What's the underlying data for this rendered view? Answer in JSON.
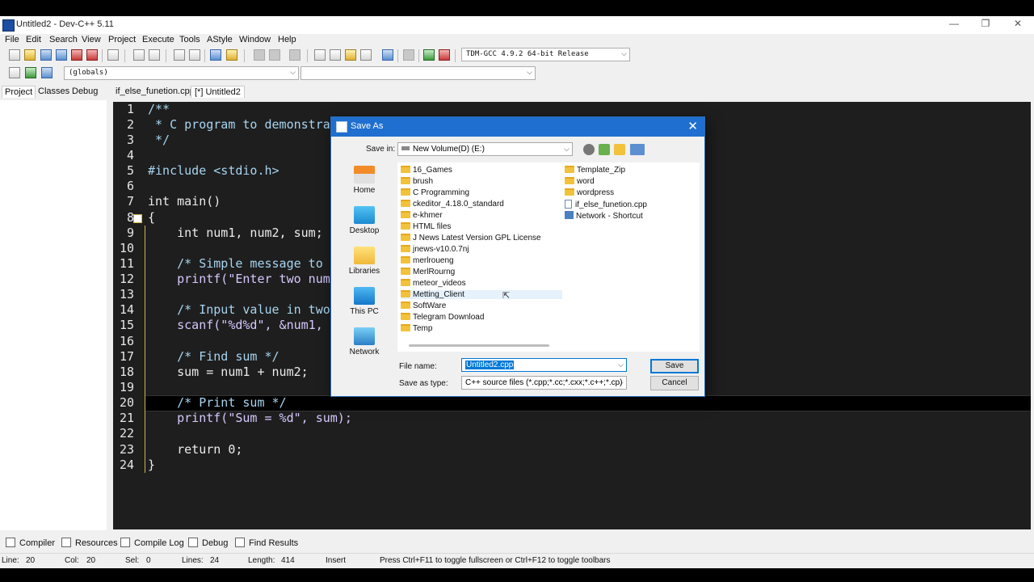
{
  "window": {
    "title": "Untitled2 - Dev-C++ 5.11",
    "controls": {
      "minimize": "—",
      "restore": "❐",
      "close": "✕"
    }
  },
  "menu": [
    "File",
    "Edit",
    "Search",
    "View",
    "Project",
    "Execute",
    "Tools",
    "AStyle",
    "Window",
    "Help"
  ],
  "toolbar": {
    "compiler_select": "TDM-GCC 4.9.2 64-bit Release",
    "scope_select": "(globals)",
    "symbol_select": ""
  },
  "left_panel": {
    "tabs": [
      "Project",
      "Classes",
      "Debug"
    ]
  },
  "file_tabs": [
    "if_else_funetion.cpp",
    "[*] Untitled2"
  ],
  "editor": {
    "line_numbers": [
      "1",
      "2",
      "3",
      "4",
      "5",
      "6",
      "7",
      "8",
      "9",
      "10",
      "11",
      "12",
      "13",
      "14",
      "15",
      "16",
      "17",
      "18",
      "19",
      "20",
      "21",
      "22",
      "23",
      "24"
    ],
    "lines": [
      "/**",
      " * C program to demonstra",
      " */",
      "",
      "#include <stdio.h>",
      "",
      "int main()",
      "{",
      "    int num1, num2, sum;",
      "",
      "    /* Simple message to",
      "    printf(\"Enter two num",
      "",
      "    /* Input value in two",
      "    scanf(\"%d%d\", &num1,",
      "",
      "    /* Find sum */",
      "    sum = num1 + num2;",
      "",
      "    /* Print sum */",
      "    printf(\"Sum = %d\", sum);",
      "",
      "    return 0;",
      "}"
    ]
  },
  "bottom_tabs": [
    "Compiler",
    "Resources",
    "Compile Log",
    "Debug",
    "Find Results"
  ],
  "status": {
    "line_label": "Line:",
    "line_value": "20",
    "col_label": "Col:",
    "col_value": "20",
    "sel_label": "Sel:",
    "sel_value": "0",
    "lines_label": "Lines:",
    "lines_value": "24",
    "length_label": "Length:",
    "length_value": "414",
    "mode": "Insert",
    "hint": "Press Ctrl+F11 to toggle fullscreen or Ctrl+F12 to toggle toolbars"
  },
  "dialog": {
    "title": "Save As",
    "close": "✕",
    "save_in_label": "Save in:",
    "save_in_value": "New Volume(D) (E:)",
    "places": [
      "Home",
      "Desktop",
      "Libraries",
      "This PC",
      "Network"
    ],
    "files_col1": [
      "16_Games",
      "brush",
      "C Programming",
      "ckeditor_4.18.0_standard",
      "e-khmer",
      "HTML files",
      "J News Latest Version GPL License",
      "jnews-v10.0.7nj",
      "merlroueng",
      "MerlRourng",
      "meteor_videos",
      "Metting_Client",
      "SoftWare",
      "Telegram Download",
      "Temp"
    ],
    "files_col2_folders": [
      "Template_Zip",
      "word",
      "wordpress"
    ],
    "files_col2_file": "if_else_funetion.cpp",
    "files_col2_shortcut": "Network - Shortcut",
    "file_name_label": "File name:",
    "file_name_value": "Untitled2.cpp",
    "save_type_label": "Save as type:",
    "save_type_value": "C++ source files (*.cpp;*.cc;*.cxx;*.c++;*.cp)",
    "save_button": "Save",
    "cancel_button": "Cancel"
  },
  "colors": {
    "accent": "#1f6fd0",
    "editor_bg": "#1e1e1e",
    "folder": "#f2c23c"
  }
}
